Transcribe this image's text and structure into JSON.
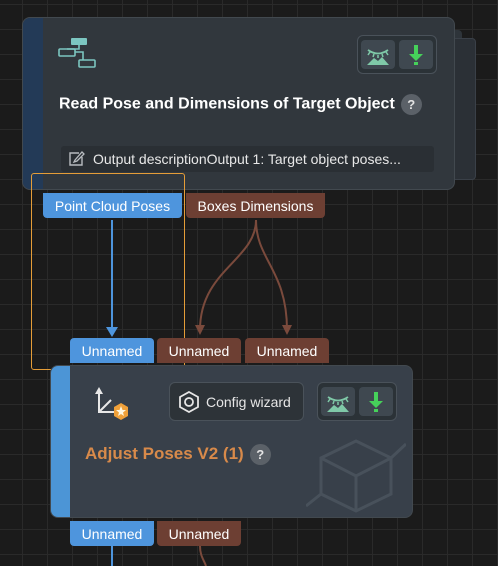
{
  "canvas": {
    "background": "#1b1b1b",
    "grid_color": "#2a2a2a",
    "link_blue": "#4e95dd",
    "link_brown": "#7a4a3c",
    "selection_color": "#e59d38"
  },
  "node_read_pose": {
    "title": "Read Pose and Dimensions of Target Object",
    "help_label": "?",
    "icon": "network-diagram-icon",
    "operation_icon": "eye-mountain-download-icon",
    "description": "Output descriptionOutput 1: Target object poses...",
    "description_icon": "edit-icon",
    "outputs": [
      {
        "label": "Point Cloud Poses",
        "color": "#4e95dd"
      },
      {
        "label": "Boxes Dimensions",
        "color": "#6d3f33"
      }
    ]
  },
  "node_adjust_poses": {
    "title": "Adjust Poses V2 (1)",
    "help_label": "?",
    "icon": "axes-star-icon",
    "config_button": "Config wizard",
    "config_icon": "hexagon-gear-icon",
    "operation_icon": "eye-mountain-download-icon",
    "inputs": [
      {
        "label": "Unnamed",
        "color": "#4e95dd"
      },
      {
        "label": "Unnamed",
        "color": "#6d3f33"
      },
      {
        "label": "Unnamed",
        "color": "#6d3f33"
      }
    ],
    "outputs": [
      {
        "label": "Unnamed",
        "color": "#4e95dd"
      },
      {
        "label": "Unnamed",
        "color": "#6d3f33"
      }
    ]
  }
}
